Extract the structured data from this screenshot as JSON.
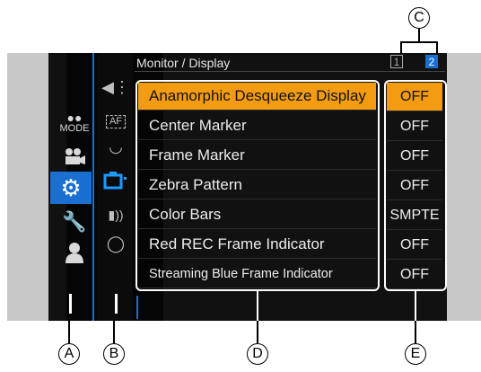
{
  "header": {
    "title": "Monitor / Display",
    "pages": [
      "1",
      "2"
    ],
    "current_page": "2"
  },
  "categories": [
    {
      "name": "mode",
      "label": "MODE",
      "icon": "camera-mode-icon"
    },
    {
      "name": "camera",
      "icon": "movie-camera-icon"
    },
    {
      "name": "setup",
      "icon": "gear-icon",
      "selected": true
    },
    {
      "name": "wrench",
      "icon": "wrench-icon"
    },
    {
      "name": "user",
      "icon": "user-icon"
    }
  ],
  "subcategories": [
    {
      "icon": "audio-icon"
    },
    {
      "icon": "af-icon",
      "label": "AF"
    },
    {
      "icon": "gauge-icon"
    },
    {
      "icon": "monitor-icon",
      "selected": true
    },
    {
      "icon": "wireless-icon"
    },
    {
      "icon": "lens-icon"
    }
  ],
  "menu": [
    {
      "label": "Anamorphic Desqueeze Display",
      "value": "OFF",
      "selected": true
    },
    {
      "label": "Center Marker",
      "value": "OFF"
    },
    {
      "label": "Frame Marker",
      "value": "OFF"
    },
    {
      "label": "Zebra Pattern",
      "value": "OFF"
    },
    {
      "label": "Color Bars",
      "value": "SMPTE"
    },
    {
      "label": "Red REC Frame Indicator",
      "value": "OFF"
    },
    {
      "label": "Streaming Blue Frame Indicator",
      "value": "OFF"
    }
  ],
  "callouts": {
    "a": "A",
    "b": "B",
    "c": "C",
    "d": "D",
    "e": "E"
  },
  "colors": {
    "highlight": "#f39c12",
    "accent": "#1a6fd0"
  }
}
